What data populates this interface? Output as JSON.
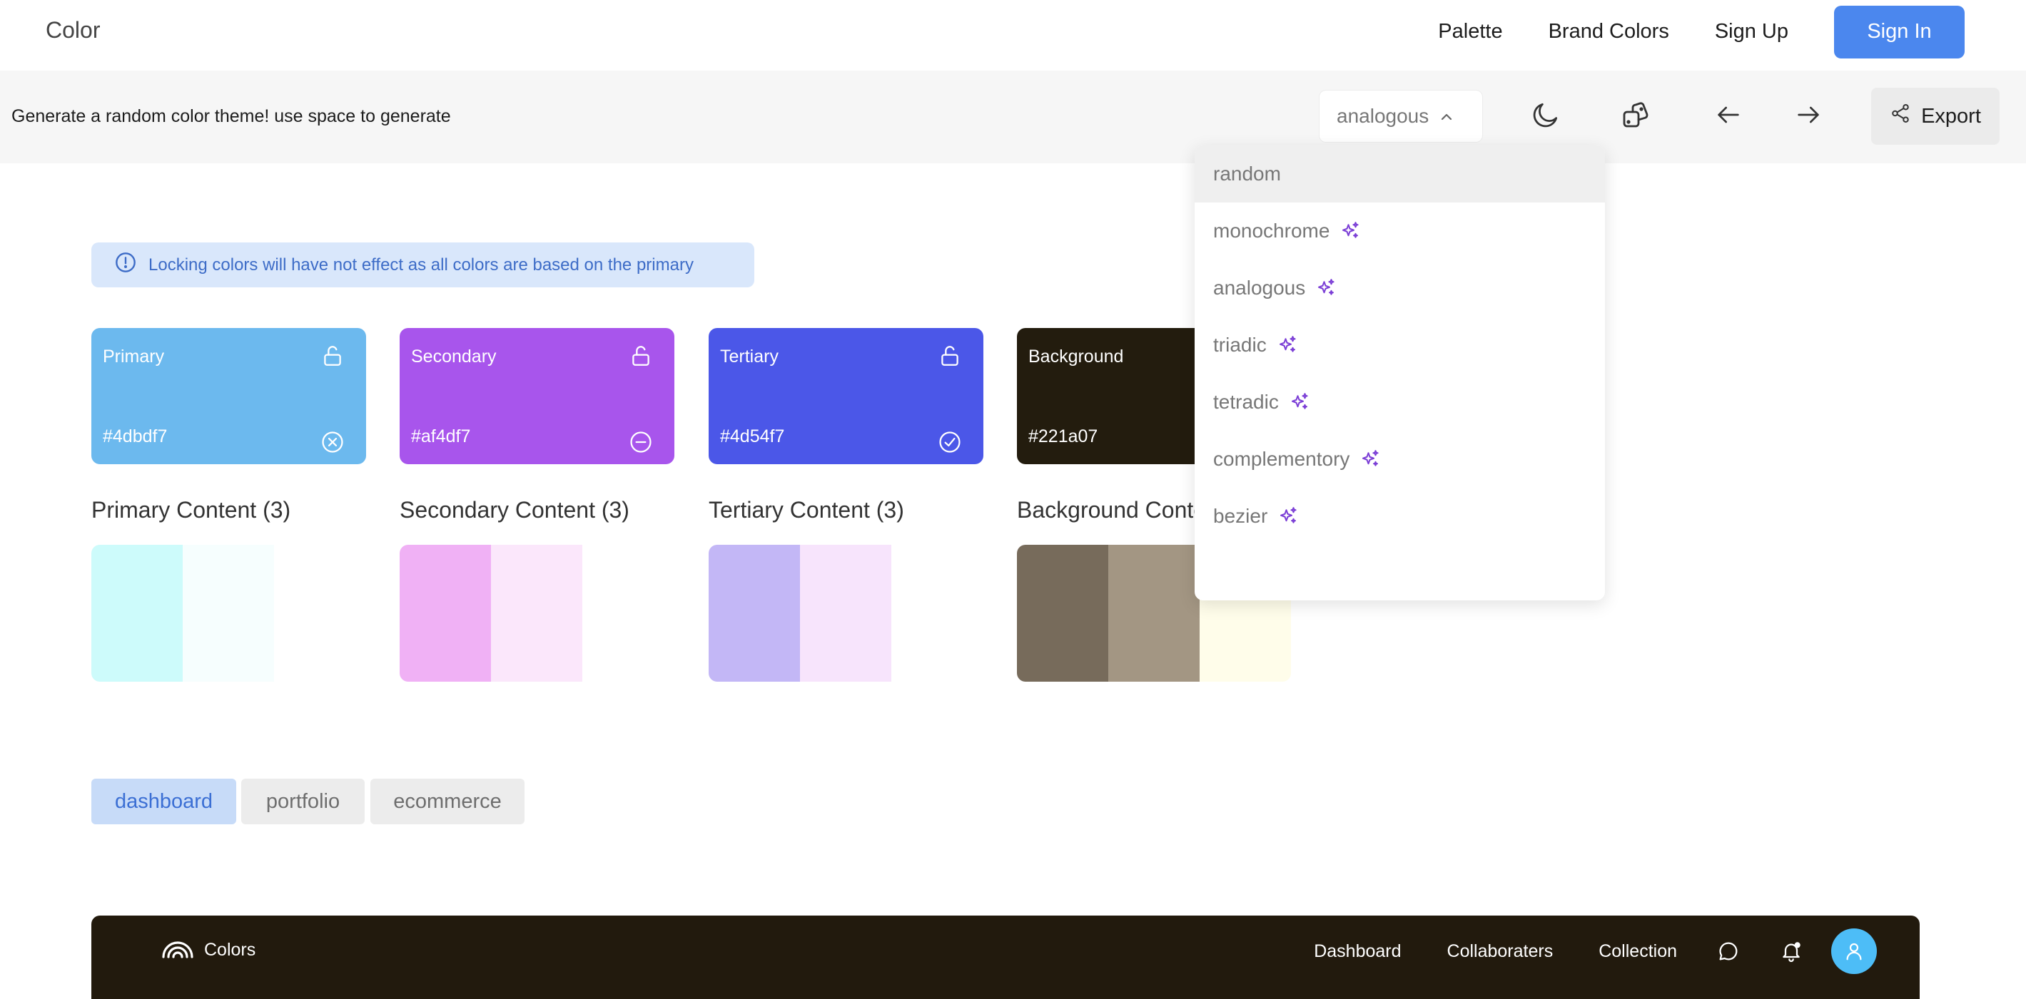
{
  "topnav": {
    "brand": "Color",
    "links": [
      "Palette",
      "Brand Colors",
      "Sign Up"
    ],
    "signin": "Sign In"
  },
  "toolbar": {
    "tagline": "Generate a random color theme! use space to generate",
    "scheme_selected": "analogous",
    "export_label": "Export"
  },
  "banner": {
    "text": "Locking colors will have not effect as all colors are based on the primary"
  },
  "colors": [
    {
      "name": "Primary",
      "hex": "#4dbdf7",
      "bg": "#6cb9ee",
      "action_icon": "close-circle-icon"
    },
    {
      "name": "Secondary",
      "hex": "#af4df7",
      "bg": "#a855ec",
      "action_icon": "minus-circle-icon"
    },
    {
      "name": "Tertiary",
      "hex": "#4d54f7",
      "bg": "#4b57e8",
      "action_icon": "check-circle-icon"
    },
    {
      "name": "Background",
      "hex": "#221a07",
      "bg": "#231c0e",
      "action_icon": "none"
    }
  ],
  "content_groups": [
    {
      "label": "Primary Content (3)",
      "swatches": [
        "#cdfbfb",
        "#f6fefe",
        "#ffffff"
      ]
    },
    {
      "label": "Secondary Content (3)",
      "swatches": [
        "#f0b1f5",
        "#fbe7fb",
        "#ffffff"
      ]
    },
    {
      "label": "Tertiary Content (3)",
      "swatches": [
        "#c3b7f6",
        "#f7e4fc",
        "#ffffff"
      ]
    },
    {
      "label": "Background Content",
      "swatches": [
        "#776b5b",
        "#a39683",
        "#fffdea"
      ]
    }
  ],
  "theme_tabs": [
    "dashboard",
    "portfolio",
    "ecommerce"
  ],
  "preview": {
    "brand": "Colors",
    "links": [
      "Dashboard",
      "Collaboraters",
      "Collection"
    ]
  },
  "dropdown": {
    "options": [
      {
        "label": "random",
        "sparkle": false
      },
      {
        "label": "monochrome",
        "sparkle": true
      },
      {
        "label": "analogous",
        "sparkle": true
      },
      {
        "label": "triadic",
        "sparkle": true
      },
      {
        "label": "tetradic",
        "sparkle": true
      },
      {
        "label": "complementory",
        "sparkle": true
      },
      {
        "label": "bezier",
        "sparkle": true
      }
    ]
  },
  "accent": {
    "brand_blue": "#4b87ee",
    "sparkle_purple": "#7b3ed6",
    "preview_bg": "#221a0d"
  }
}
